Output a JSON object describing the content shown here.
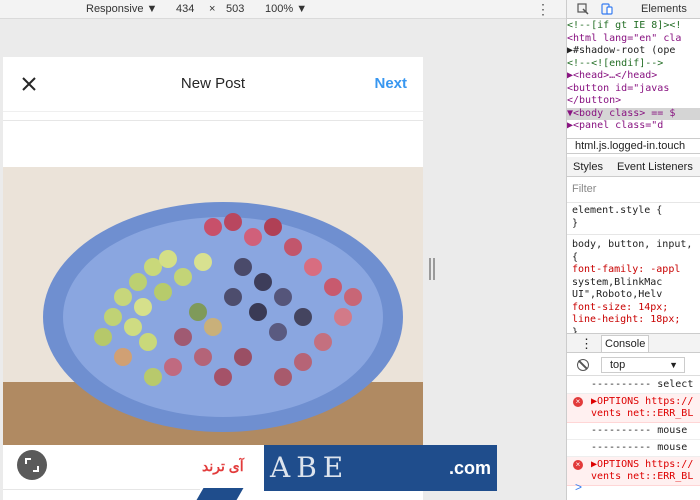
{
  "device_toolbar": {
    "device": "Responsive",
    "width": "434",
    "times": "×",
    "height": "503",
    "zoom": "100%"
  },
  "post": {
    "title": "New Post",
    "next": "Next",
    "close_icon": "close-icon"
  },
  "watermark": {
    "fa_text": "آی ترند",
    "letters": "ABE",
    "domain": ".com"
  },
  "devtools": {
    "tab": "Elements",
    "dom_lines": [
      {
        "text": "<!--[if gt IE 8]><!",
        "kind": "cmt"
      },
      {
        "text": "<html lang=\"en\" cla",
        "kind": "tag"
      },
      {
        "text": "▶#shadow-root (ope",
        "kind": "plain"
      },
      {
        "text": "  <!--<![endif]-->",
        "kind": "cmt"
      },
      {
        "text": " ▶<head>…</head>",
        "kind": "tag"
      },
      {
        "text": "  <button id=\"javas",
        "kind": "tag"
      },
      {
        "text": "  </button>",
        "kind": "tag"
      },
      {
        "text": "▼<body class> == $",
        "kind": "tag"
      },
      {
        "text": " ▶<panel class=\"d",
        "kind": "tag"
      }
    ],
    "breadcrumb": "html.js.logged-in.touch",
    "styles_tab": "Styles",
    "listeners_tab": "Event Listeners",
    "filter": "Filter",
    "styles_lines": [
      {
        "text": "element.style {",
        "kind": "sel"
      },
      {
        "text": "}",
        "kind": "sel"
      },
      {
        "text": "body, button, input,",
        "kind": "sel"
      },
      {
        "text": "{",
        "kind": "sel"
      },
      {
        "text": "  font-family: -appl",
        "kind": "prop"
      },
      {
        "text": "    system,BlinkMac",
        "kind": "plain"
      },
      {
        "text": "    UI\",Roboto,Helv",
        "kind": "plain"
      },
      {
        "text": "  font-size: 14px;",
        "kind": "prop"
      },
      {
        "text": "  line-height: 18px;",
        "kind": "prop"
      },
      {
        "text": "}",
        "kind": "sel"
      }
    ],
    "console_tab": "Console",
    "context": "top",
    "messages": [
      {
        "text": "---------- select",
        "err": false
      },
      {
        "text": "▶OPTIONS https://",
        "text2": "vents net::ERR_BL",
        "err": true
      },
      {
        "text": "---------- mouse",
        "err": false
      },
      {
        "text": "---------- mouse",
        "err": false
      },
      {
        "text": "▶OPTIONS https://",
        "text2": "vents net::ERR_BL",
        "err": true
      }
    ],
    "prompt": ">"
  }
}
